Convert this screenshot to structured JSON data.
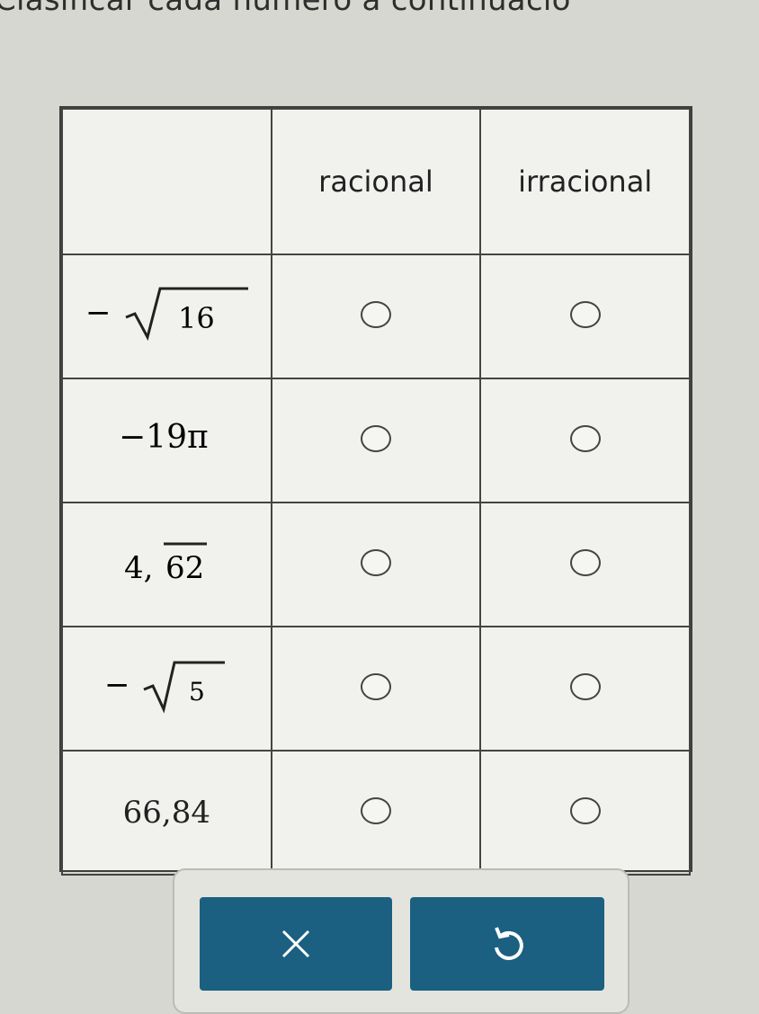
{
  "instruction": "Clasificar cada número a continuació",
  "table": {
    "headers": [
      "",
      "racional",
      "irracional"
    ],
    "rows": [
      {
        "number": "−√16"
      },
      {
        "number": "−19π"
      },
      {
        "number": "4,62 (repeating 62)"
      },
      {
        "number": "−√5"
      },
      {
        "number": "66,84"
      }
    ]
  },
  "buttons": {
    "clear": "✕",
    "undo": "↺"
  },
  "colors": {
    "button": "#1b6080",
    "background": "#d7d7d1"
  }
}
